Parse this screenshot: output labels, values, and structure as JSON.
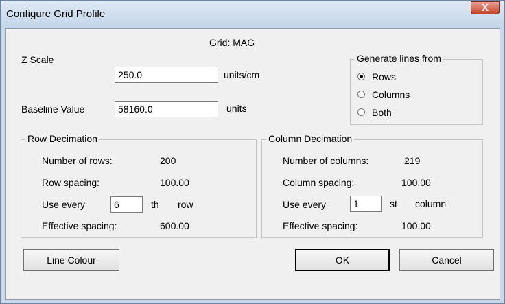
{
  "window": {
    "title": "Configure Grid Profile",
    "close_glyph": "X"
  },
  "grid_label": "Grid: MAG",
  "z_scale": {
    "label": "Z Scale",
    "value": "250.0",
    "unit": "units/cm"
  },
  "baseline": {
    "label": "Baseline Value",
    "value": "58160.0",
    "unit": "units"
  },
  "generate": {
    "title": "Generate lines from",
    "options": [
      {
        "label": "Rows",
        "selected": true
      },
      {
        "label": "Columns",
        "selected": false
      },
      {
        "label": "Both",
        "selected": false
      }
    ]
  },
  "row_decimation": {
    "title": "Row Decimation",
    "count_label": "Number of rows:",
    "count": "200",
    "spacing_label": "Row spacing:",
    "spacing": "100.00",
    "use_every_label": "Use every",
    "use_every": "6",
    "suffix": "th",
    "unit": "row",
    "effective_label": "Effective spacing:",
    "effective": "600.00"
  },
  "column_decimation": {
    "title": "Column Decimation",
    "count_label": "Number of columns:",
    "count": "219",
    "spacing_label": "Column spacing:",
    "spacing": "100.00",
    "use_every_label": "Use every",
    "use_every": "1",
    "suffix": "st",
    "unit": "column",
    "effective_label": "Effective spacing:",
    "effective": "100.00"
  },
  "buttons": {
    "line_colour": "Line Colour",
    "ok": "OK",
    "cancel": "Cancel"
  }
}
